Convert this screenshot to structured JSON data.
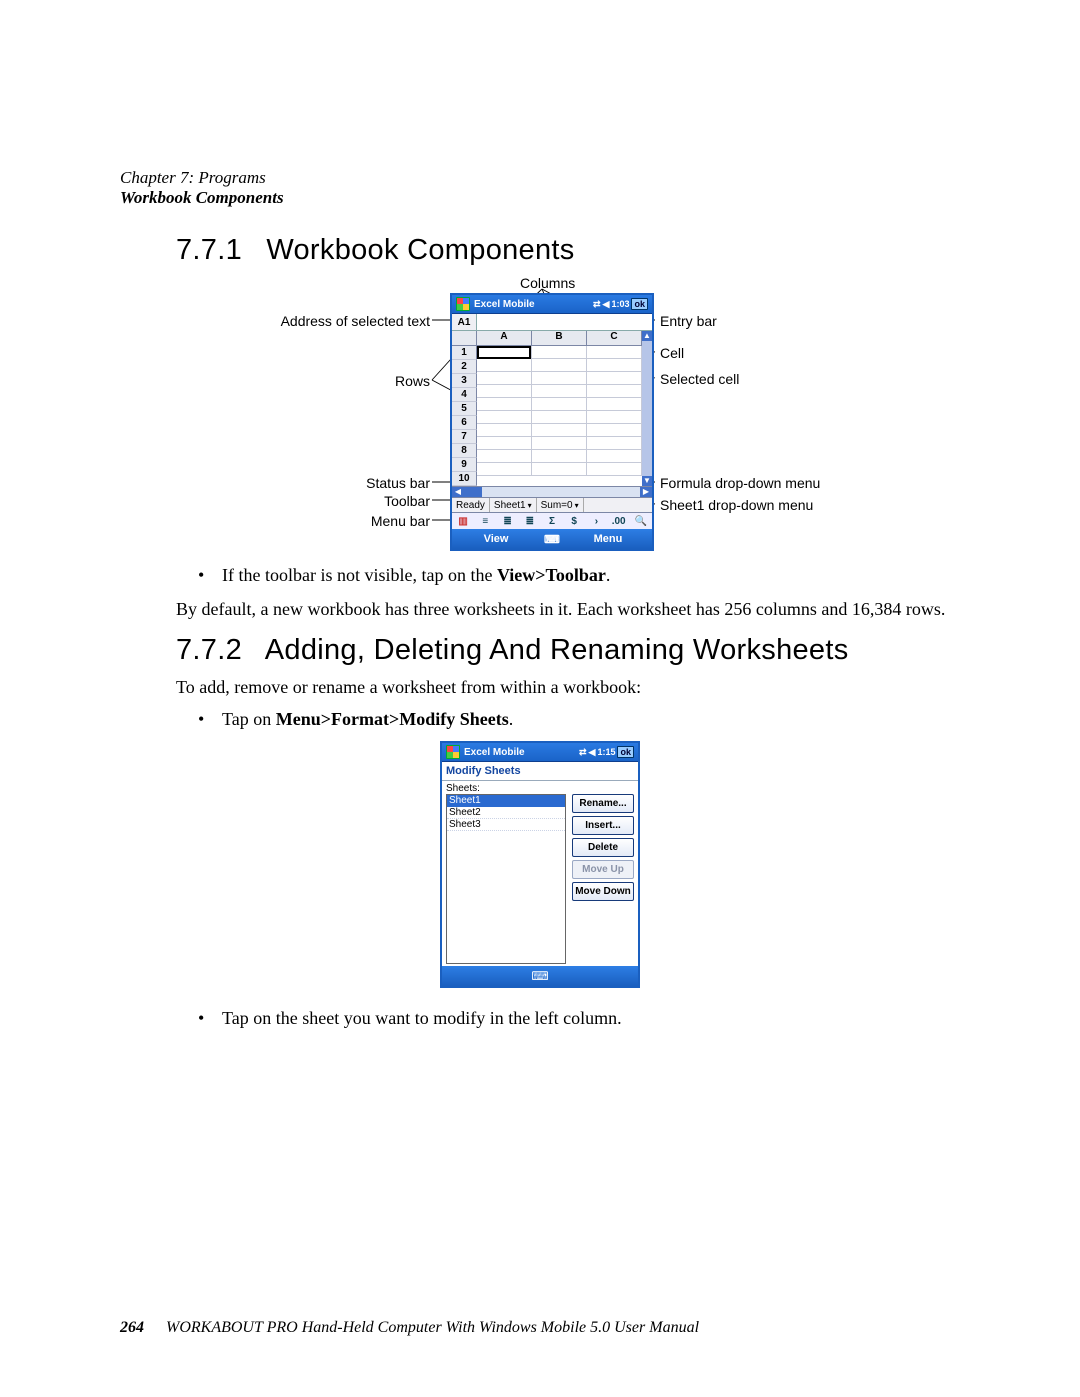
{
  "header": {
    "chapter": "Chapter 7: Programs",
    "section": "Workbook Components"
  },
  "sections": {
    "s1": {
      "num": "7.7.1",
      "title": "Workbook Components"
    },
    "s2": {
      "num": "7.7.2",
      "title": "Adding, Deleting And Renaming Worksheets"
    }
  },
  "callouts": {
    "columns": "Columns",
    "address": "Address of selected text",
    "rows": "Rows",
    "status": "Status bar",
    "toolbar": "Toolbar",
    "menubar": "Menu bar",
    "entrybar": "Entry bar",
    "cell": "Cell",
    "selected": "Selected cell",
    "formula_dd": "Formula drop-down menu",
    "sheet_dd": "Sheet1 drop-down menu"
  },
  "excel1": {
    "title": "Excel Mobile",
    "time": "1:03",
    "ok": "ok",
    "address": "A1",
    "cols": [
      "A",
      "B",
      "C"
    ],
    "rows": [
      "1",
      "2",
      "3",
      "4",
      "5",
      "6",
      "7",
      "8",
      "9",
      "10"
    ],
    "status_ready": "Ready",
    "status_sheet": "Sheet1",
    "status_sum": "Sum=0",
    "menu_view": "View",
    "menu_menu": "Menu",
    "tb_icons": [
      "≡",
      "≣",
      "≣",
      "Σ",
      "$",
      "›",
      ".00",
      "🔍"
    ]
  },
  "bullets1": {
    "b1a": "If the toolbar is not visible, tap on the ",
    "b1b": "View>Toolbar"
  },
  "para1": "By default, a new workbook has three worksheets in it. Each worksheet has 256 columns and 16,384 rows.",
  "para2": "To add, remove or rename a worksheet from within a workbook:",
  "bullets2": {
    "b1a": "Tap on ",
    "b1b": "Menu>Format>Modify Sheets"
  },
  "excel2": {
    "title": "Excel Mobile",
    "time": "1:15",
    "ok": "ok",
    "dialog_title": "Modify Sheets",
    "sheets_label": "Sheets:",
    "sheets": [
      "Sheet1",
      "Sheet2",
      "Sheet3"
    ],
    "buttons": {
      "rename": "Rename...",
      "insert": "Insert...",
      "delete": "Delete",
      "moveup": "Move Up",
      "movedown": "Move Down"
    }
  },
  "bullets3": {
    "b1": "Tap on the sheet you want to modify in the left column."
  },
  "footer": {
    "page": "264",
    "text": "WORKABOUT PRO Hand-Held Computer With Windows Mobile 5.0 User Manual"
  }
}
